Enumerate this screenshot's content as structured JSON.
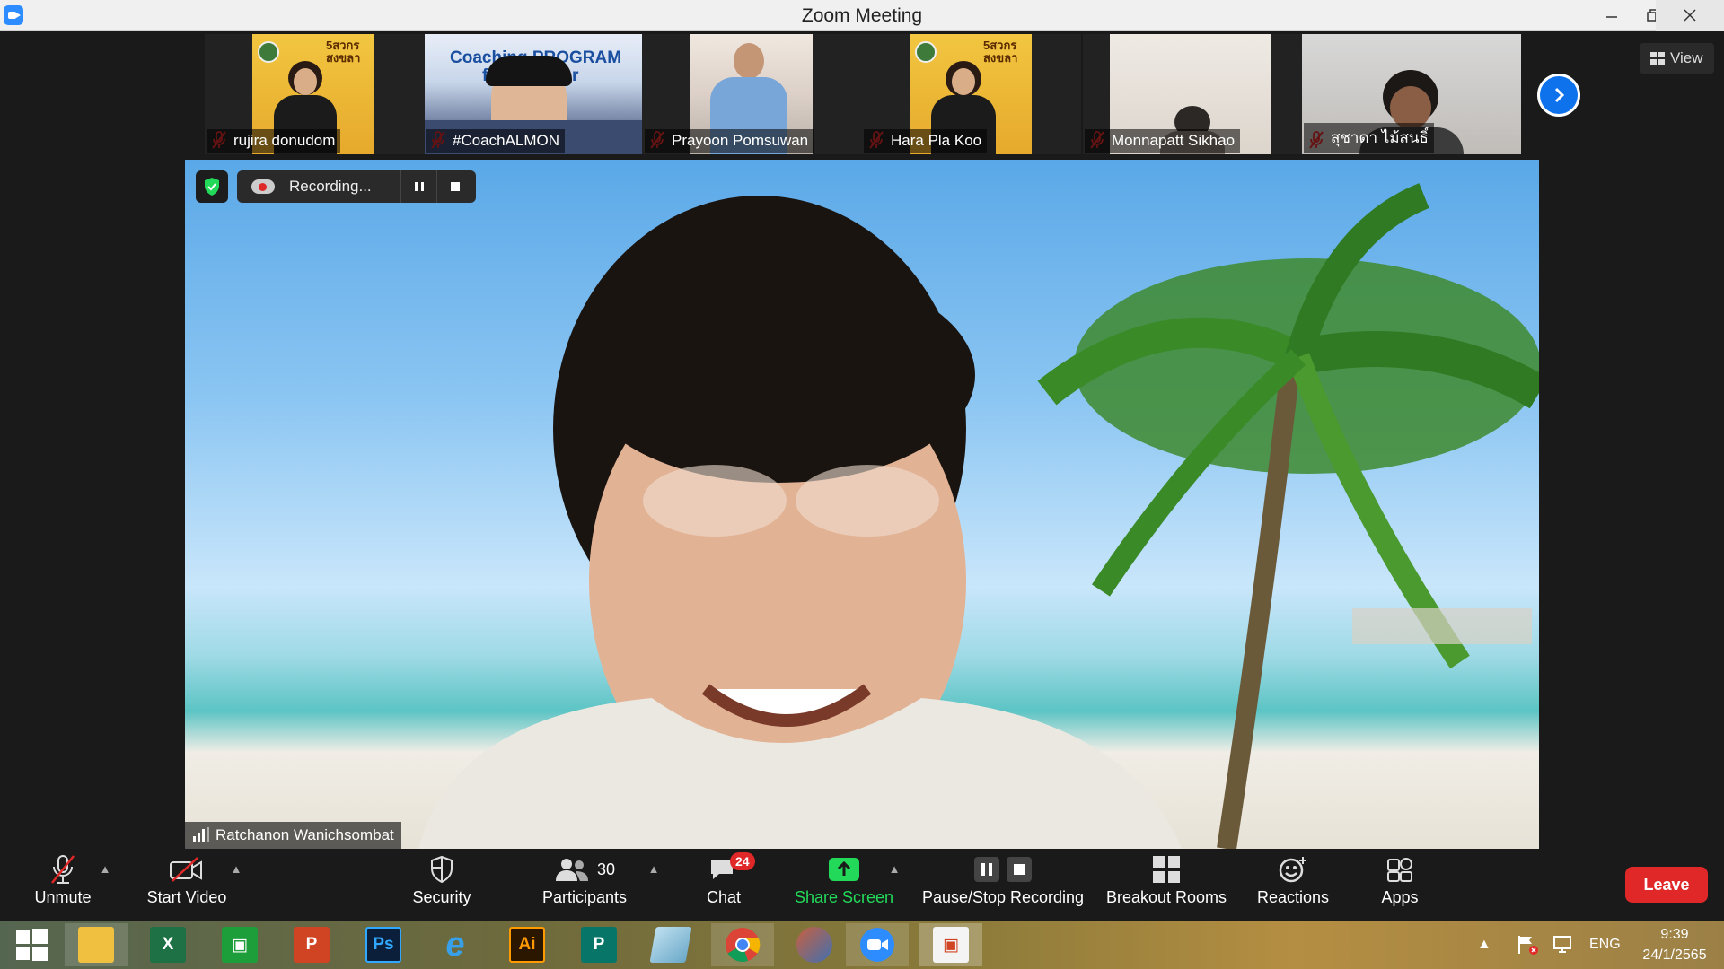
{
  "window": {
    "title": "Zoom Meeting"
  },
  "participants_strip": {
    "tiles": [
      {
        "name": "rujira donudom"
      },
      {
        "name": "#CoachALMON"
      },
      {
        "name": "Prayoon Pomsuwan"
      },
      {
        "name": "Hara Pla Koo"
      },
      {
        "name": "Monnapatt Sikhao"
      },
      {
        "name": "สุชาดา ไม้สนธิ์"
      }
    ],
    "tile_overlay_text": [
      "Coaching PROGRAM",
      "for",
      "rer"
    ],
    "poster_text": "5สวกร สงขลา",
    "view_label": "View"
  },
  "main_video": {
    "recording_label": "Recording...",
    "speaker_name": "Ratchanon Wanichsombat"
  },
  "toolbar": {
    "unmute": "Unmute",
    "start_video": "Start Video",
    "security": "Security",
    "participants": "Participants",
    "participants_count": "30",
    "chat": "Chat",
    "chat_badge": "24",
    "share_screen": "Share Screen",
    "pause_stop_recording": "Pause/Stop Recording",
    "breakout_rooms": "Breakout Rooms",
    "reactions": "Reactions",
    "apps": "Apps",
    "leave": "Leave",
    "share_color": "#23d959",
    "leave_color": "#e02828"
  },
  "taskbar": {
    "apps": [
      {
        "name": "file-explorer",
        "label": ""
      },
      {
        "name": "excel",
        "label": "X"
      },
      {
        "name": "store",
        "label": ""
      },
      {
        "name": "powerpoint",
        "label": "P"
      },
      {
        "name": "photoshop",
        "label": "Ps"
      },
      {
        "name": "internet-explorer",
        "label": "e"
      },
      {
        "name": "illustrator",
        "label": "Ai"
      },
      {
        "name": "publisher",
        "label": "P"
      },
      {
        "name": "notes",
        "label": ""
      },
      {
        "name": "chrome",
        "label": ""
      },
      {
        "name": "app-tool",
        "label": ""
      },
      {
        "name": "zoom",
        "label": ""
      },
      {
        "name": "powerpoint-alt",
        "label": ""
      }
    ],
    "language": "ENG",
    "time": "9:39",
    "date": "24/1/2565"
  }
}
